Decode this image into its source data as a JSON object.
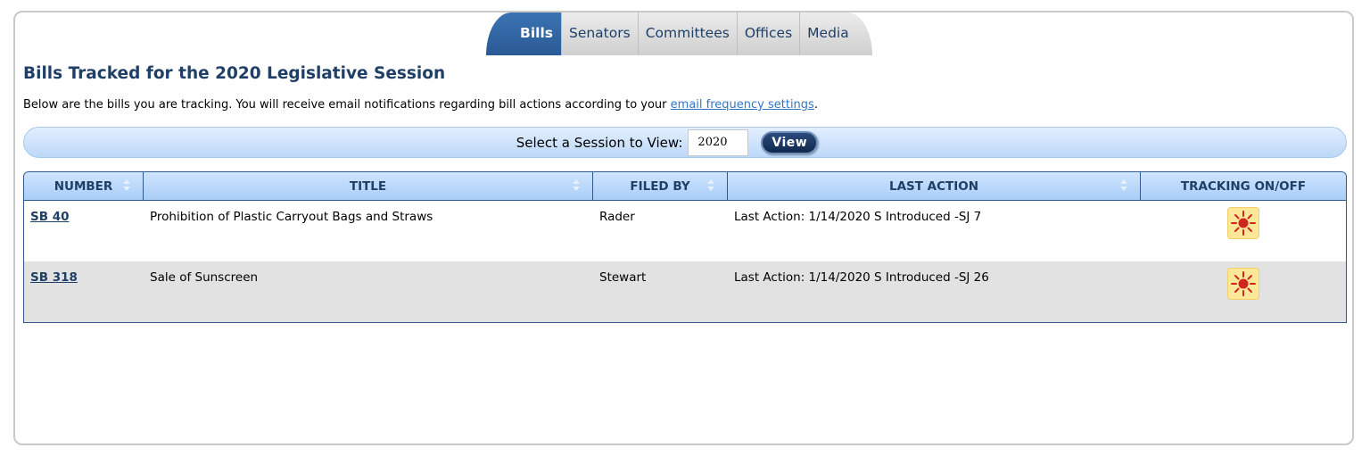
{
  "nav": {
    "tabs": [
      {
        "label": "Bills",
        "active": true
      },
      {
        "label": "Senators",
        "active": false
      },
      {
        "label": "Committees",
        "active": false
      },
      {
        "label": "Offices",
        "active": false
      },
      {
        "label": "Media",
        "active": false
      }
    ]
  },
  "page": {
    "title": "Bills Tracked for the 2020 Legislative Session",
    "intro_prefix": "Below are the bills you are tracking. You will receive email notifications regarding bill actions according to your ",
    "intro_link": "email frequency settings",
    "intro_suffix": "."
  },
  "session": {
    "label": "Select a Session to View:",
    "value": "2020",
    "button": "View"
  },
  "table": {
    "columns": [
      "NUMBER",
      "TITLE",
      "FILED BY",
      "LAST ACTION",
      "TRACKING ON/OFF"
    ],
    "rows": [
      {
        "number": "SB 40",
        "title": "Prohibition of Plastic Carryout Bags and Straws",
        "filed_by": "Rader",
        "last_action": "Last Action: 1/14/2020 S Introduced -SJ 7",
        "tracking_icon": "sun-icon"
      },
      {
        "number": "SB 318",
        "title": "Sale of Sunscreen",
        "filed_by": "Stewart",
        "last_action": "Last Action: 1/14/2020 S Introduced -SJ 26",
        "tracking_icon": "sun-icon"
      }
    ]
  },
  "colors": {
    "brand_blue": "#1f3f66",
    "active_tab": "#2a5a95",
    "link": "#2f76c9",
    "tracking_icon_bg": "#fde89a",
    "tracking_icon_fg": "#d0271d"
  }
}
